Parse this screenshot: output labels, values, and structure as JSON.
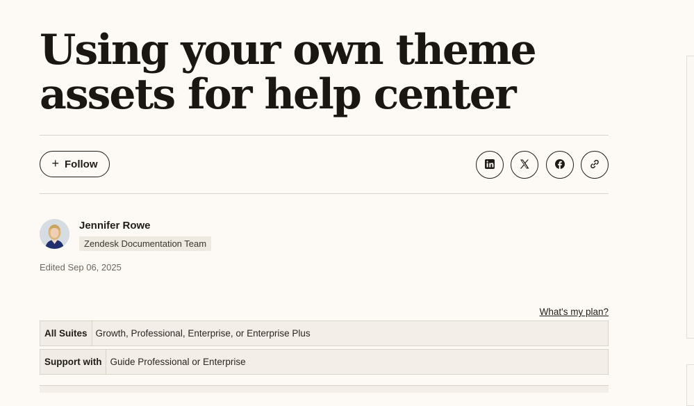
{
  "article": {
    "title": "Using your own theme assets for help center"
  },
  "actions": {
    "follow_label": "Follow",
    "share": [
      {
        "icon": "linkedin-icon"
      },
      {
        "icon": "x-icon"
      },
      {
        "icon": "facebook-icon"
      },
      {
        "icon": "link-icon"
      }
    ]
  },
  "author": {
    "name": "Jennifer Rowe",
    "team": "Zendesk Documentation Team",
    "edited": "Edited Sep 06, 2025"
  },
  "plans": {
    "link_label": "What's my plan?",
    "rows": [
      {
        "label": "All Suites",
        "value": "Growth, Professional, Enterprise, or Enterprise Plus"
      },
      {
        "label": "Support with",
        "value": "Guide Professional or Enterprise"
      }
    ]
  },
  "colors": {
    "background": "#fdfaf5",
    "text": "#1f1c17",
    "plan_row_bg": "#f3efe8",
    "border": "#d8d3cb"
  }
}
